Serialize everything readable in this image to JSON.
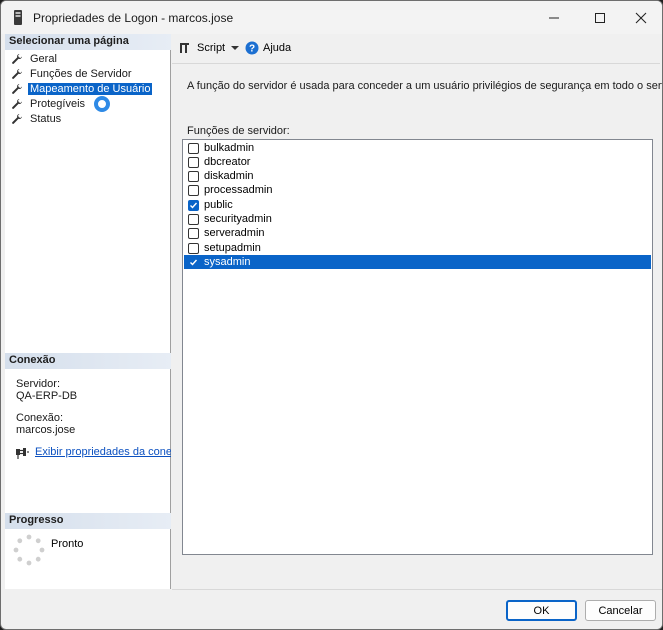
{
  "window": {
    "title": "Propriedades de Logon - marcos.jose"
  },
  "left": {
    "select_page_header": "Selecionar uma página",
    "pages": [
      {
        "label": "Geral",
        "selected": false
      },
      {
        "label": "Funções de Servidor",
        "selected": false
      },
      {
        "label": "Mapeamento de Usuário",
        "selected": true
      },
      {
        "label": "Protegíveis",
        "selected": false
      },
      {
        "label": "Status",
        "selected": false
      }
    ],
    "connection_header": "Conexão",
    "server_label": "Servidor:",
    "server_value": "QA-ERP-DB",
    "connection_label": "Conexão:",
    "connection_value": "marcos.jose",
    "view_connection_link": "Exibir propriedades da conexão",
    "progress_header": "Progresso",
    "progress_status": "Pronto"
  },
  "toolbar": {
    "script_label": "Script",
    "help_label": "Ajuda"
  },
  "main": {
    "description": "A função do servidor é usada para conceder a um usuário privilégios de segurança em todo o servidor.",
    "roles_label": "Funções de servidor:",
    "roles": [
      {
        "name": "bulkadmin",
        "checked": false
      },
      {
        "name": "dbcreator",
        "checked": false
      },
      {
        "name": "diskadmin",
        "checked": false
      },
      {
        "name": "processadmin",
        "checked": false
      },
      {
        "name": "public",
        "checked": true
      },
      {
        "name": "securityadmin",
        "checked": false
      },
      {
        "name": "serveradmin",
        "checked": false
      },
      {
        "name": "setupadmin",
        "checked": false
      },
      {
        "name": "sysadmin",
        "checked": true
      }
    ],
    "highlighted_role": "sysadmin"
  },
  "buttons": {
    "ok_label": "OK",
    "cancel_label": "Cancelar"
  },
  "colors": {
    "selection": "#0a64c8",
    "link": "#0b50c0",
    "cursor_ring": "#2e8ae6"
  }
}
